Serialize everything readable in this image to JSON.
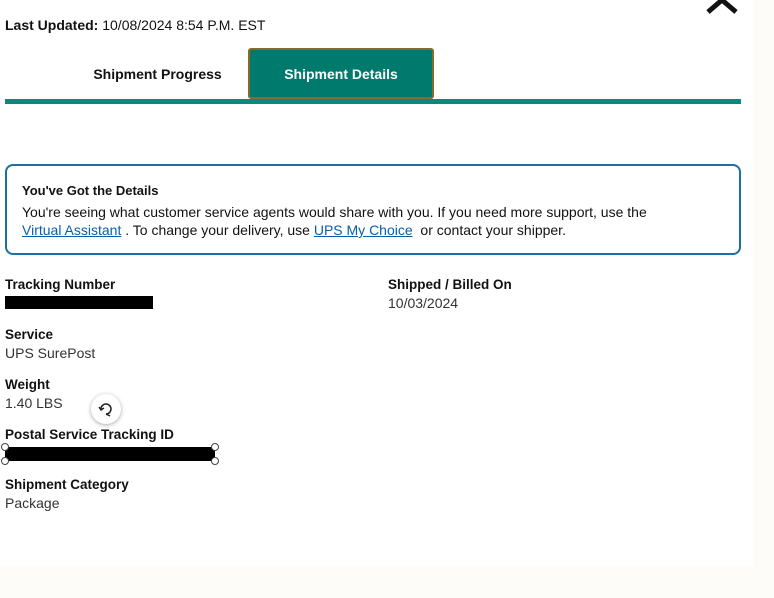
{
  "header": {
    "last_updated_label": "Last Updated:",
    "last_updated_value": "10/08/2024 8:54 P.M. EST",
    "close_icon": "chevron-up-icon"
  },
  "tabs": [
    {
      "label": "Shipment Progress",
      "active": false
    },
    {
      "label": "Shipment Details",
      "active": true
    }
  ],
  "colors": {
    "accent": "#007a6c",
    "alert_border": "#1a6fa3",
    "link": "#0a5ea8"
  },
  "alert": {
    "title": "You've Got the Details",
    "body_start": "You're seeing what customer service agents would share with you. If you need more support, use the",
    "link1": "Virtual Assistant",
    "body_mid": " . To change your delivery, use ",
    "link2": "UPS My Choice",
    "body_end": "  or contact your shipper."
  },
  "details": {
    "tracking_number": {
      "label": "Tracking Number",
      "redacted": true
    },
    "shipped_billed_on": {
      "label": "Shipped / Billed On",
      "value": "10/03/2024"
    },
    "service": {
      "label": "Service",
      "value": "UPS SurePost"
    },
    "weight": {
      "label": "Weight",
      "value": "1.40 LBS"
    },
    "postal_tracking_id": {
      "label": "Postal Service Tracking ID",
      "redacted": true
    },
    "shipment_category": {
      "label": "Shipment Category",
      "value": "Package"
    }
  },
  "overlay": {
    "rotate_icon": "rotate-icon"
  }
}
